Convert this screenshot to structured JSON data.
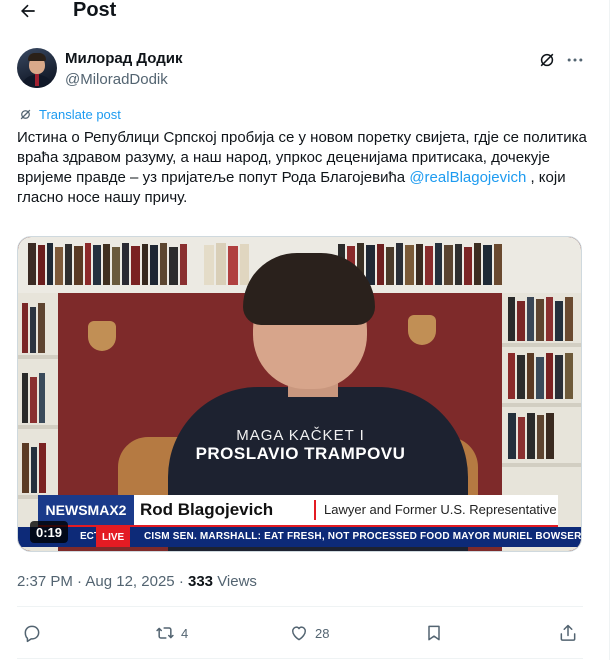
{
  "header": {
    "title": "Post",
    "back_icon": "arrow-left-icon"
  },
  "author": {
    "name": "Милорад Додик",
    "handle": "@MiloradDodik"
  },
  "translate": {
    "label": "Translate post",
    "icon": "translate-icon"
  },
  "post": {
    "text_before": "Истина о Републици Српској пробија се у новом поретку свијета, гдје се политика враћа здравом разуму, а наш народ, упркос деценијама притисака, дочекује вријеме правде – уз пријатеље попут Рода Благојевића ",
    "mention": "@realBlagojevich",
    "text_after": " , који гласно носе нашу причу."
  },
  "video": {
    "duration": "0:19",
    "caption_line1": "MAGA KAČKET I",
    "caption_line2": "PROSLAVIO TRAMPOVU",
    "channel_logo": "NEWSMAX2",
    "lower_third_name": "Rod Blagojevich",
    "lower_third_title": "Lawyer and Former U.S. Representative",
    "ticker_live": "LIVE",
    "ticker_prefix": "ECT",
    "ticker_text": "CISM    SEN. MARSHALL: EAT FRESH, NOT PROCESSED FOOD    MAYOR MURIEL BOWSER:"
  },
  "meta": {
    "time": "2:37 PM",
    "date": "Aug 12, 2025",
    "views_count": "333",
    "views_label": "Views",
    "separator": "·"
  },
  "actions": {
    "reply": {
      "icon": "reply-icon",
      "count": ""
    },
    "repost": {
      "icon": "repost-icon",
      "count": "4"
    },
    "like": {
      "icon": "heart-icon",
      "count": "28"
    },
    "bookmark": {
      "icon": "bookmark-icon",
      "count": ""
    },
    "share": {
      "icon": "share-icon",
      "count": ""
    }
  },
  "colors": {
    "link": "#1d9bf0",
    "secondary_text": "#536471",
    "primary_text": "#0f1419",
    "divider": "#eff3f4"
  }
}
